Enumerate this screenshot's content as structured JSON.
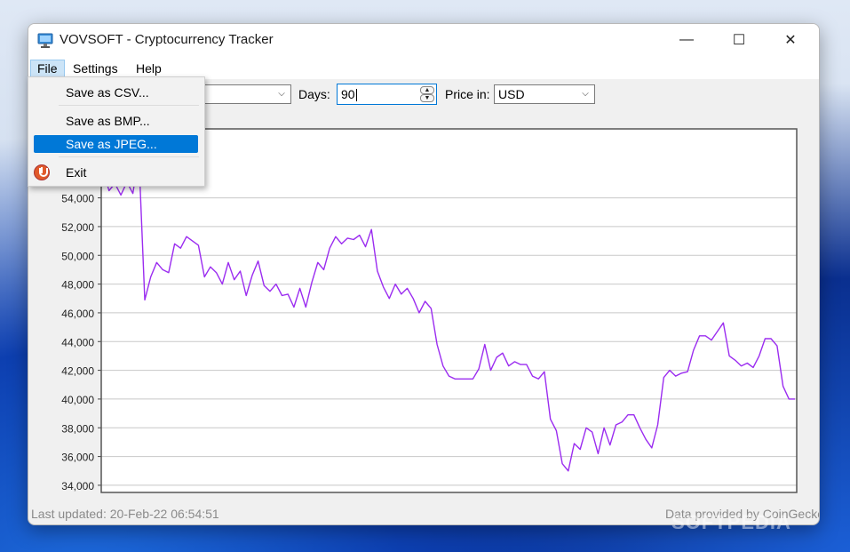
{
  "window": {
    "title": "VOVSOFT - Cryptocurrency Tracker",
    "controls": {
      "minimize": "—",
      "maximize": "☐",
      "close": "✕"
    }
  },
  "menu": {
    "file": "File",
    "settings": "Settings",
    "help": "Help"
  },
  "file_menu": {
    "save_csv": "Save as CSV...",
    "save_bmp": "Save as BMP...",
    "save_jpeg": "Save as JPEG...",
    "exit": "Exit"
  },
  "toolbar": {
    "coin_value": "",
    "days_label": "Days:",
    "days_value": "90",
    "price_label": "Price in:",
    "currency_value": "USD"
  },
  "status": {
    "last_updated": "Last updated: 20-Feb-22 06:54:51",
    "provider": "Data provided by CoinGecko"
  },
  "watermark": "SOFTPEDIA",
  "colors": {
    "line": "#9b2cf0",
    "accent": "#0078d7"
  },
  "chart_data": {
    "type": "line",
    "title": "",
    "xlabel": "",
    "ylabel": "",
    "ylim": [
      33500,
      58800
    ],
    "yticks": [
      34000,
      36000,
      38000,
      40000,
      42000,
      44000,
      46000,
      48000,
      50000,
      52000,
      54000
    ],
    "ytick_labels": [
      "34,000",
      "36,000",
      "38,000",
      "40,000",
      "42,000",
      "44,000",
      "46,000",
      "48,000",
      "50,000",
      "52,000",
      "54,000"
    ],
    "grid": true,
    "series": [
      {
        "values": [
          56000,
          54500,
          55000,
          54200,
          55100,
          54300,
          57000,
          46900,
          48500,
          49500,
          49000,
          48800,
          50800,
          50500,
          51300,
          51000,
          50700,
          48500,
          49200,
          48800,
          48000,
          49500,
          48300,
          48900,
          47200,
          48600,
          49600,
          47900,
          47500,
          48000,
          47200,
          47300,
          46400,
          47700,
          46400,
          48100,
          49500,
          49000,
          50500,
          51300,
          50800,
          51200,
          51100,
          51400,
          50600,
          51800,
          48900,
          47800,
          47000,
          48000,
          47300,
          47700,
          47000,
          46000,
          46800,
          46300,
          43800,
          42300,
          41600,
          41400,
          41400,
          41400,
          41400,
          42100,
          43800,
          42000,
          42900,
          43200,
          42300,
          42600,
          42400,
          42400,
          41600,
          41400,
          41900,
          38600,
          37800,
          35500,
          35000,
          36900,
          36500,
          38000,
          37700,
          36200,
          38000,
          36800,
          38200,
          38400,
          38900,
          38900,
          38000,
          37200,
          36600,
          38200,
          41500,
          42000,
          41600,
          41800,
          41900,
          43400,
          44400,
          44400,
          44100,
          44700,
          45300,
          43000,
          42700,
          42300,
          42500,
          42200,
          43000,
          44200,
          44200,
          43700,
          40900,
          40000,
          40000
        ]
      }
    ]
  }
}
